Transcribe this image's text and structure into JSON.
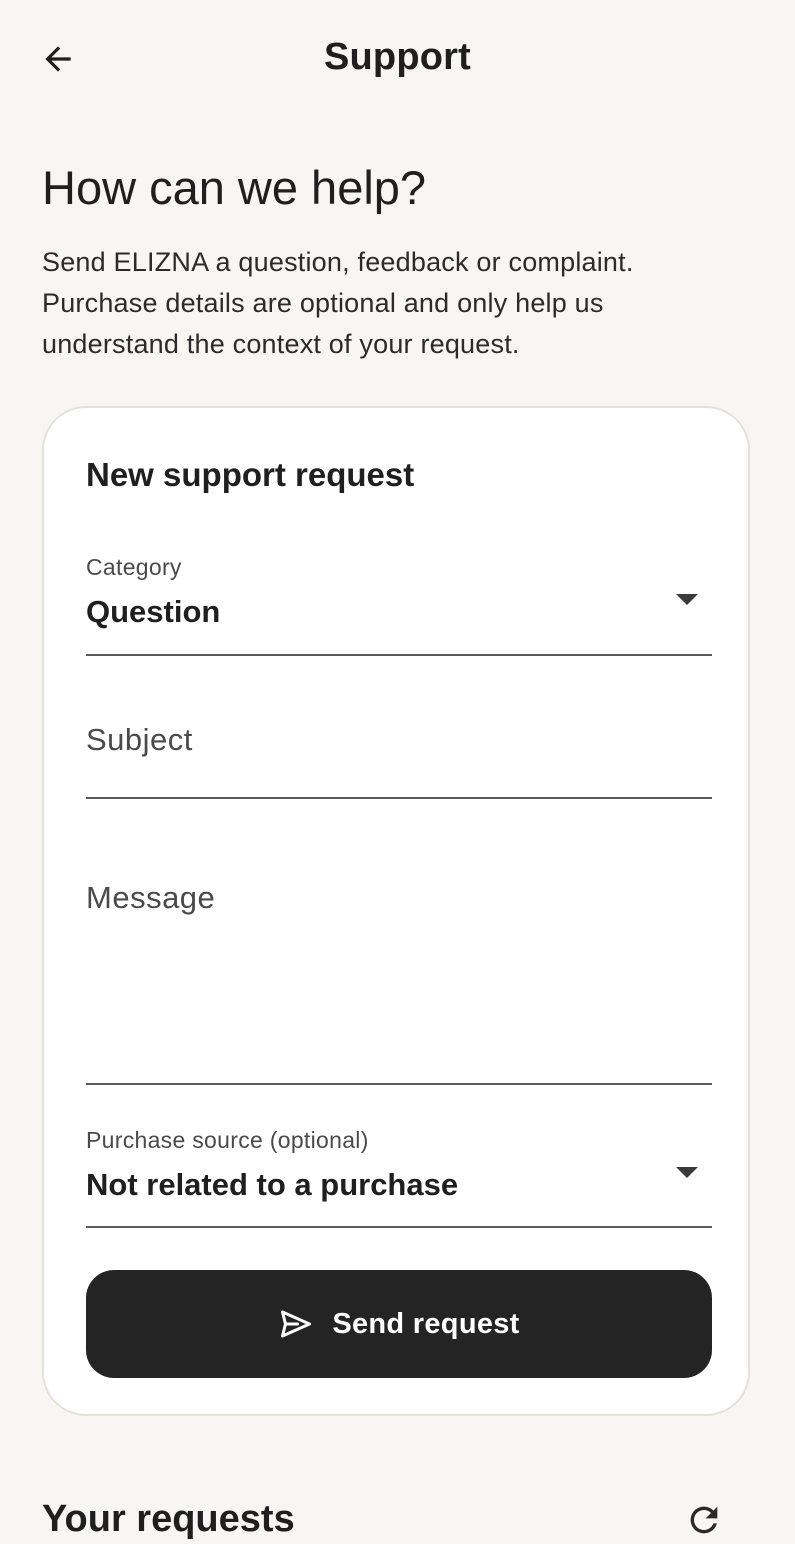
{
  "appbar": {
    "title": "Support",
    "back_icon": "arrow-left-icon"
  },
  "intro": {
    "headline": "How can we help?",
    "description": "Send ELIZNA a question, feedback or complaint. Purchase details are optional and only help us understand the context of your request."
  },
  "form": {
    "title": "New support request",
    "category": {
      "label": "Category",
      "value": "Question"
    },
    "subject": {
      "placeholder": "Subject"
    },
    "message": {
      "placeholder": "Message"
    },
    "purchase_source": {
      "label": "Purchase source (optional)",
      "value": "Not related to a purchase"
    },
    "send_button": {
      "label": "Send request",
      "icon": "send-icon"
    }
  },
  "requests": {
    "title": "Your requests",
    "refresh_icon": "refresh-icon"
  },
  "colors": {
    "background": "#f7f6f2",
    "card": "#ffffff",
    "primary_button": "#242424",
    "text": "#1f1f1f"
  }
}
